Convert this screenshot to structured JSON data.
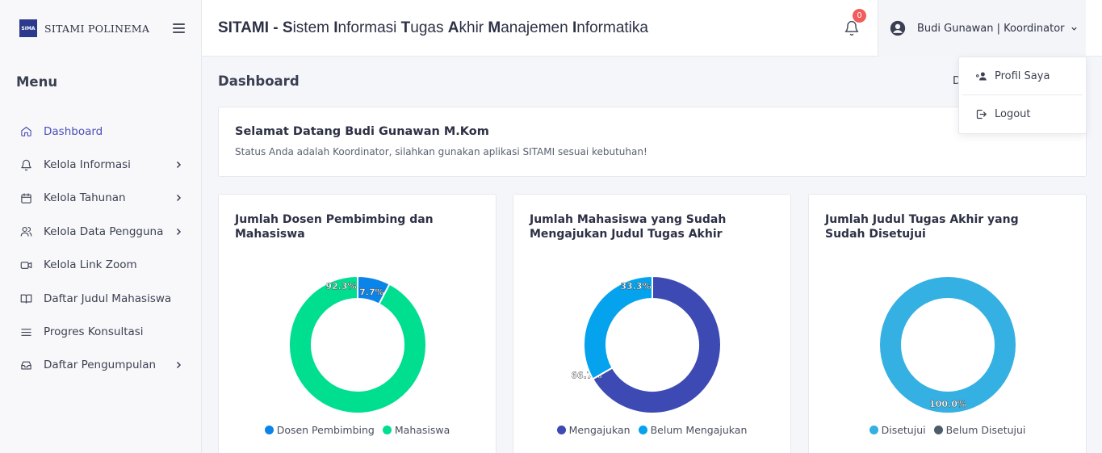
{
  "brand": {
    "logo_text": "SIMA",
    "name": "SITAMI POLINEMA"
  },
  "sidebar": {
    "menu_title": "Menu",
    "items": [
      {
        "label": "Dashboard",
        "icon": "home-icon",
        "active": true,
        "has_children": false
      },
      {
        "label": "Kelola Informasi",
        "icon": "bell-icon",
        "active": false,
        "has_children": true
      },
      {
        "label": "Kelola Tahunan",
        "icon": "calendar-icon",
        "active": false,
        "has_children": true
      },
      {
        "label": "Kelola Data Pengguna",
        "icon": "users-icon",
        "active": false,
        "has_children": true
      },
      {
        "label": "Kelola Link Zoom",
        "icon": "video-icon",
        "active": false,
        "has_children": false
      },
      {
        "label": "Daftar Judul Mahasiswa",
        "icon": "book-icon",
        "active": false,
        "has_children": false
      },
      {
        "label": "Progres Konsultasi",
        "icon": "list-icon",
        "active": false,
        "has_children": false
      },
      {
        "label": "Daftar Pengumpulan",
        "icon": "inbox-icon",
        "active": false,
        "has_children": true
      }
    ]
  },
  "header": {
    "title_parts": [
      {
        "text": "SITAMI",
        "bold": true
      },
      {
        "text": " - ",
        "bold": true
      },
      {
        "text": "S",
        "bold": true
      },
      {
        "text": "istem ",
        "bold": false
      },
      {
        "text": "I",
        "bold": true
      },
      {
        "text": "nformasi ",
        "bold": false
      },
      {
        "text": "T",
        "bold": true
      },
      {
        "text": "ugas ",
        "bold": false
      },
      {
        "text": "A",
        "bold": true
      },
      {
        "text": "khir ",
        "bold": false
      },
      {
        "text": "M",
        "bold": true
      },
      {
        "text": "anajemen ",
        "bold": false
      },
      {
        "text": "I",
        "bold": true
      },
      {
        "text": "nformatika",
        "bold": false
      }
    ],
    "notification_count": "0",
    "user_label": "Budi Gunawan | Koordinator"
  },
  "user_dropdown": {
    "items": [
      {
        "label": "Profil Saya",
        "icon": "user-cog-icon"
      },
      {
        "label": "Logout",
        "icon": "logout-icon"
      }
    ]
  },
  "main": {
    "page_title": "Dashboard",
    "breadcrumb": "D",
    "welcome_title": "Selamat Datang Budi Gunawan M.Kom",
    "welcome_text": "Status Anda adalah Koordinator, silahkan gunakan aplikasi SITAMI sesuai kebutuhan!"
  },
  "colors": {
    "accent": "#4a4fb5",
    "badge": "#f15c5c",
    "blue": "#0a84e8",
    "green": "#00de8f",
    "indigo": "#3d4ab4",
    "sky": "#05a3ee",
    "cyan": "#34b0e2",
    "slate": "#4d5c6b"
  },
  "chart_data": [
    {
      "type": "pie",
      "title": "Jumlah Dosen Pembimbing dan Mahasiswa",
      "categories": [
        "Dosen Pembimbing",
        "Mahasiswa"
      ],
      "values": [
        7.7,
        92.3
      ],
      "labels": [
        "7.7%",
        "92.3%"
      ],
      "colors": [
        "#0a84e8",
        "#00de8f"
      ],
      "legend": "bottom"
    },
    {
      "type": "pie",
      "title": "Jumlah Mahasiswa yang Sudah Mengajukan Judul Tugas Akhir",
      "categories": [
        "Mengajukan",
        "Belum Mengajukan"
      ],
      "values": [
        66.7,
        33.3
      ],
      "labels": [
        "66.7%",
        "33.3%"
      ],
      "colors": [
        "#3d4ab4",
        "#05a3ee"
      ],
      "legend": "bottom"
    },
    {
      "type": "pie",
      "title": "Jumlah Judul Tugas Akhir yang Sudah Disetujui",
      "categories": [
        "Disetujui",
        "Belum Disetujui"
      ],
      "values": [
        100.0,
        0.0
      ],
      "labels": [
        "100.0%",
        ""
      ],
      "colors": [
        "#34b0e2",
        "#4d5c6b"
      ],
      "legend": "bottom"
    }
  ]
}
